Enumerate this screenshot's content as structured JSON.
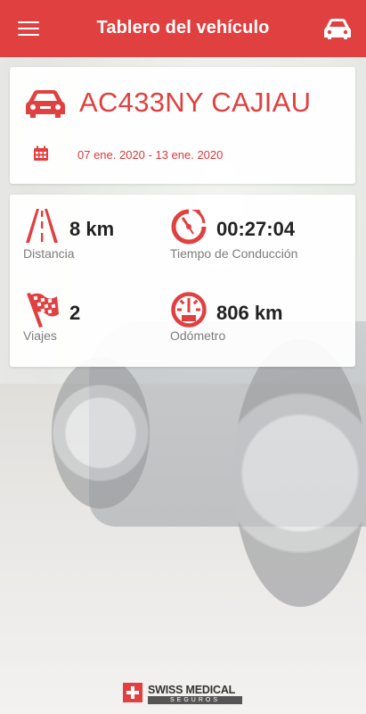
{
  "header": {
    "title": "Tablero del vehículo",
    "menu_icon": "menu-icon",
    "car_icon": "car-icon"
  },
  "vehicle": {
    "plate": "AC433NY CAJIAU",
    "date_range": "07 ene. 2020 - 13 ene. 2020",
    "icon": "car-icon",
    "calendar_icon": "calendar-icon"
  },
  "stats": {
    "distance": {
      "value": "8 km",
      "label": "Distancia",
      "icon": "road-icon"
    },
    "driving_time": {
      "value": "00:27:04",
      "label": "Tiempo de Conducción",
      "icon": "stopwatch-icon"
    },
    "trips": {
      "value": "2",
      "label": "Viajes",
      "icon": "checkered-flag-icon"
    },
    "odometer": {
      "value": "806 km",
      "label": "Odómetro",
      "icon": "gauge-icon"
    }
  },
  "footer": {
    "brand": "SWISS MEDICAL",
    "brand_sub": "SEGUROS"
  },
  "colors": {
    "accent": "#e04040",
    "label_gray": "#7c7c7c",
    "value_dark": "#222222"
  }
}
